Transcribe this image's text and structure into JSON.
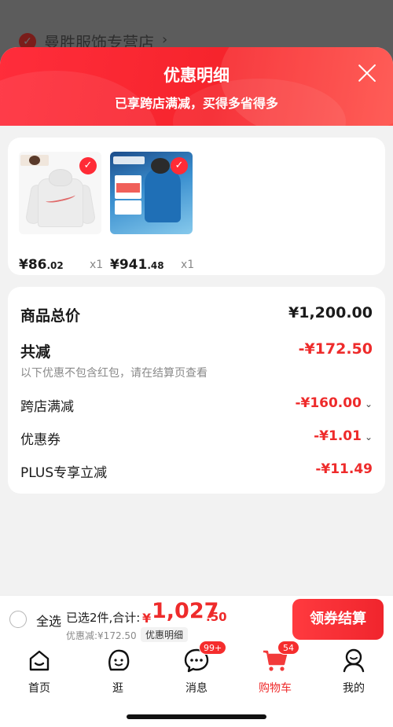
{
  "background": {
    "store_name": "曼胜服饰专营店",
    "chevron": "›"
  },
  "sheet": {
    "title": "优惠明细",
    "subtitle": "已享跨店满减，买得多省得多",
    "close_icon": "close-icon"
  },
  "products": [
    {
      "name": "hoodie",
      "price_int": "¥86",
      "price_dec": ".02",
      "qty": "x1",
      "selected": true
    },
    {
      "name": "jacket",
      "price_int": "¥941",
      "price_dec": ".48",
      "qty": "x1",
      "selected": true
    }
  ],
  "summary": {
    "total_label": "商品总价",
    "total_value": "¥1,200.00",
    "reduce_label": "共减",
    "reduce_value": "-¥172.50",
    "reduce_note": "以下优惠不包含红包，请在结算页查看",
    "items": [
      {
        "label": "跨店满减",
        "value": "-¥160.00",
        "expandable": true
      },
      {
        "label": "优惠券",
        "value": "-¥1.01",
        "expandable": true
      },
      {
        "label": "PLUS专享立减",
        "value": "-¥11.49",
        "expandable": false
      }
    ]
  },
  "checkout": {
    "select_all": "全选",
    "selected_info": "已选2件,合计:",
    "currency": "¥",
    "total_int": "1,027",
    "total_dec": ".50",
    "discount_line": "优惠减:¥172.50",
    "discount_detail_link": "优惠明细",
    "button": "领券结算"
  },
  "tabs": [
    {
      "label": "首页",
      "icon": "home-icon",
      "badge": ""
    },
    {
      "label": "逛",
      "icon": "browse-icon",
      "badge": ""
    },
    {
      "label": "消息",
      "icon": "message-icon",
      "badge": "99+"
    },
    {
      "label": "购物车",
      "icon": "cart-icon",
      "badge": "54",
      "active": true
    },
    {
      "label": "我的",
      "icon": "profile-icon",
      "badge": ""
    }
  ],
  "colors": {
    "accent_red": "#ee2b2b",
    "header_red": "#f6242c",
    "background": "#f2f2f2"
  }
}
